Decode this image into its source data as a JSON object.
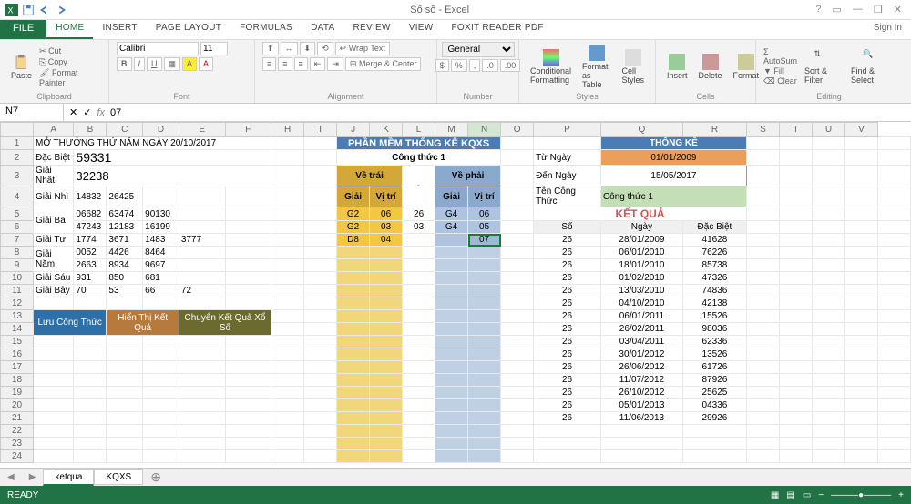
{
  "app": {
    "title": "Sổ số - Excel",
    "signin": "Sign In"
  },
  "tabs": [
    "HOME",
    "INSERT",
    "PAGE LAYOUT",
    "FORMULAS",
    "DATA",
    "REVIEW",
    "VIEW",
    "FOXIT READER PDF"
  ],
  "ribbon": {
    "clipboard": {
      "cut": "Cut",
      "copy": "Copy",
      "paint": "Format Painter",
      "label": "Clipboard"
    },
    "font": {
      "name": "Calibri",
      "size": "11",
      "label": "Font"
    },
    "align": {
      "wrap": "Wrap Text",
      "merge": "Merge & Center",
      "label": "Alignment"
    },
    "number": {
      "label": "Number"
    },
    "styles": {
      "cond": "Conditional Formatting",
      "fmt": "Format as Table",
      "cell": "Cell Styles",
      "label": "Styles"
    },
    "cells": {
      "ins": "Insert",
      "del": "Delete",
      "fmt": "Format",
      "label": "Cells"
    },
    "editing": {
      "sum": "AutoSum",
      "fill": "Fill",
      "clear": "Clear",
      "sort": "Sort & Filter",
      "find": "Find & Select",
      "label": "Editing"
    }
  },
  "namebox": "N7",
  "formula": "07",
  "cols": [
    "A",
    "B",
    "C",
    "D",
    "E",
    "F",
    "H",
    "I",
    "J",
    "K",
    "L",
    "M",
    "N",
    "O",
    "P",
    "Q",
    "R",
    "S",
    "T",
    "U",
    "V"
  ],
  "lottery": {
    "header": "MỞ THƯỞNG THỨ NĂM NGÀY 20/10/2017",
    "labels": {
      "db": "Đặc Biệt",
      "g1": "Giải Nhất",
      "g2": "Giải Nhì",
      "g3": "Giải Ba",
      "g4": "Giải Tư",
      "g5": "Giải Năm",
      "g6": "Giải Sáu",
      "g7": "Giải Bảy"
    },
    "db": "59331",
    "g1": "32238",
    "g2": [
      "14832",
      "26425"
    ],
    "g3": [
      "06682",
      "63474",
      "90130",
      "47243",
      "12183",
      "16199"
    ],
    "g4": [
      "1774",
      "3671",
      "1483",
      "3777"
    ],
    "g5": [
      "0052",
      "4426",
      "8464",
      "2663",
      "8934",
      "9697"
    ],
    "g6": [
      "931",
      "850",
      "681"
    ],
    "g7": [
      "70",
      "53",
      "66",
      "72"
    ]
  },
  "buttons": {
    "save": "Lưu Công Thức",
    "show": "Hiển Thị Kết Quả",
    "convert": "Chuyển Kết Quả Xổ Số"
  },
  "pm": {
    "title": "PHẦN MỀM THỐNG KÊ KQXS",
    "sub": "Công thức 1",
    "left_h": "Về trái",
    "right_h": "Về phải",
    "g": "Giải",
    "v": "Vị trí",
    "left": [
      [
        "G2",
        "06"
      ],
      [
        "G2",
        "03"
      ],
      [
        "D8",
        "04"
      ]
    ],
    "mid": [
      "26",
      "03",
      ""
    ],
    "right": [
      [
        "G4",
        "06"
      ],
      [
        "G4",
        "05"
      ],
      [
        "",
        "07"
      ]
    ]
  },
  "tk": {
    "title": "THỐNG KÊ",
    "from_l": "Từ Ngày",
    "from": "01/01/2009",
    "to_l": "Đến Ngày",
    "to": "15/05/2017",
    "name_l": "Tên Công Thức",
    "name": "Công thức 1",
    "kq": "KẾT QUẢ",
    "cols": [
      "Số",
      "Ngày",
      "Đặc Biệt"
    ],
    "rows": [
      [
        "26",
        "28/01/2009",
        "41628"
      ],
      [
        "26",
        "06/01/2010",
        "76226"
      ],
      [
        "26",
        "18/01/2010",
        "85738"
      ],
      [
        "26",
        "01/02/2010",
        "47326"
      ],
      [
        "26",
        "13/03/2010",
        "74836"
      ],
      [
        "26",
        "04/10/2010",
        "42138"
      ],
      [
        "26",
        "06/01/2011",
        "15526"
      ],
      [
        "26",
        "26/02/2011",
        "98036"
      ],
      [
        "26",
        "03/04/2011",
        "62336"
      ],
      [
        "26",
        "30/01/2012",
        "13526"
      ],
      [
        "26",
        "26/06/2012",
        "61726"
      ],
      [
        "26",
        "11/07/2012",
        "87926"
      ],
      [
        "26",
        "26/10/2012",
        "25625"
      ],
      [
        "26",
        "05/01/2013",
        "04336"
      ],
      [
        "26",
        "11/06/2013",
        "29926"
      ]
    ]
  },
  "sheets": [
    "ketqua",
    "KQXS"
  ],
  "status": "READY"
}
